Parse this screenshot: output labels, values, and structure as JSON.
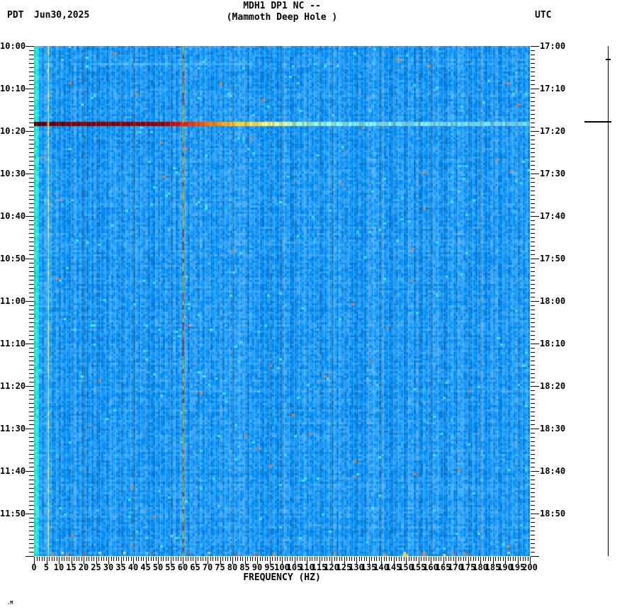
{
  "header": {
    "tz_left": "PDT",
    "date": "Jun30,2025",
    "tz_right": "UTC",
    "title_line1": "MDH1 DP1 NC --",
    "title_line2": "(Mammoth Deep Hole )"
  },
  "chart_data": {
    "type": "heatmap",
    "title": "MDH1 DP1 NC --",
    "subtitle": "(Mammoth Deep Hole )",
    "xlabel": "FREQUENCY (HZ)",
    "x_min_hz": 0,
    "x_max_hz": 200,
    "x_major_tick_step_hz": 5,
    "x_minor_tick_step_hz": 1,
    "grid_step_hz": 5,
    "x_tick_labels": [
      "0",
      "5",
      "10",
      "15",
      "20",
      "25",
      "30",
      "35",
      "40",
      "45",
      "50",
      "55",
      "60",
      "65",
      "70",
      "75",
      "80",
      "85",
      "90",
      "95",
      "100",
      "105",
      "110",
      "115",
      "120",
      "125",
      "130",
      "135",
      "140",
      "145",
      "150",
      "155",
      "160",
      "165",
      "170",
      "175",
      "180",
      "185",
      "190",
      "195",
      "200"
    ],
    "time_start_left": "10:00",
    "time_span_minutes": 120,
    "minor_time_tick_minutes": 1,
    "major_time_tick_minutes": 10,
    "left_time_ticks": [
      "10:00",
      "10:10",
      "10:20",
      "10:30",
      "10:40",
      "10:50",
      "11:00",
      "11:10",
      "11:20",
      "11:30",
      "11:40",
      "11:50"
    ],
    "right_time_ticks": [
      "17:00",
      "17:10",
      "17:20",
      "17:30",
      "17:40",
      "17:50",
      "18:00",
      "18:10",
      "18:20",
      "18:30",
      "18:40",
      "18:50"
    ],
    "timezone_left": "PDT",
    "timezone_right": "UTC",
    "background_style": "random blue seismic-noise texture",
    "noise_palette_hint": [
      "#0550D8",
      "#0E7BF2",
      "#2FA8FF",
      "#55D2FF"
    ],
    "noise_seed": 20250630,
    "grid_color": "rgba(128,122,88,0.5)",
    "features": [
      {
        "name": "broadband-event-band",
        "time_left": "10:18",
        "time_right": "17:18",
        "duration_minutes": 1,
        "gradient_stops_hz_color": [
          [
            0,
            "#5E0000"
          ],
          [
            20,
            "#7C0000"
          ],
          [
            52,
            "#980000"
          ],
          [
            55,
            "#D00000"
          ],
          [
            62,
            "#FF2600"
          ],
          [
            72,
            "#FF8000"
          ],
          [
            82,
            "#FFC820"
          ],
          [
            90,
            "#FFE95A"
          ],
          [
            98,
            "#DCF488"
          ],
          [
            105,
            "#A9EFAF"
          ],
          [
            115,
            "#8BE8D2"
          ],
          [
            135,
            "#79DCEC"
          ],
          [
            200,
            "#6CC8E8"
          ]
        ]
      },
      {
        "name": "power-line-60hz",
        "freq_hz": 60,
        "segment_colors": [
          "#A8A82A",
          "#B8B838",
          "#8C3A1E",
          "#C05020",
          "#96A02C"
        ]
      },
      {
        "name": "microseism-column",
        "freq_hz": 5.5,
        "segment_colors": [
          "#59DFC3",
          "#7FE9B6",
          "#A9EF8F",
          "#D3EC66",
          "#63E0DC"
        ]
      },
      {
        "name": "faint-light-row",
        "time_left": "10:04",
        "hz_from": 23,
        "hz_to": 89,
        "color": "rgba(130,225,255,0.30)"
      }
    ]
  },
  "side_trace": {
    "spike_time_left": "10:18",
    "marker_time_left": "10:03"
  },
  "watermark": ".M"
}
